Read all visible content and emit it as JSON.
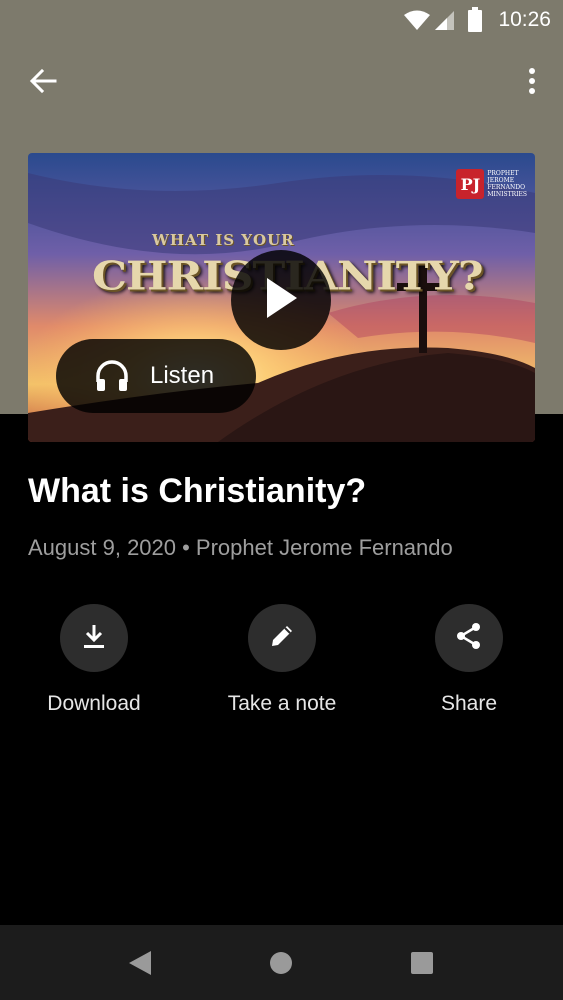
{
  "status_bar": {
    "time": "10:26",
    "icons": [
      "wifi-icon",
      "cell-signal-icon",
      "battery-icon"
    ]
  },
  "app_bar": {
    "back_icon": "arrow-left-icon",
    "menu_icon": "more-vert-icon"
  },
  "hero": {
    "artwork_title_small": "WHAT IS YOUR",
    "artwork_title_large": "CHRISTIANITY?",
    "logo_mark": "PJ",
    "logo_text": [
      "PROPHET",
      "JEROME",
      "FERNANDO",
      "MINISTRIES"
    ],
    "play_icon": "play-icon",
    "listen_icon": "headphones-icon",
    "listen_label": "Listen"
  },
  "sermon": {
    "title": "What is Christianity?",
    "meta": "August 9, 2020 • Prophet Jerome Fernando"
  },
  "actions": [
    {
      "label": "Download",
      "icon": "download-icon"
    },
    {
      "label": "Take a note",
      "icon": "pencil-icon"
    },
    {
      "label": "Share",
      "icon": "share-icon"
    }
  ],
  "nav": {
    "back_icon": "nav-back-icon",
    "home_icon": "nav-home-icon",
    "recents_icon": "nav-recents-icon"
  },
  "colors": {
    "header_band": "#7d7a6c",
    "background": "#000000",
    "action_circle": "#2d2d2d",
    "meta_text": "#9e9e9e",
    "logo_red": "#c8232c"
  }
}
